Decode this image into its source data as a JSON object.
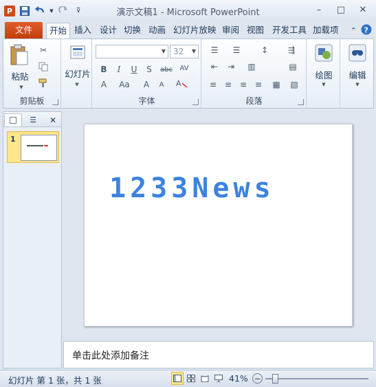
{
  "window": {
    "title": "演示文稿1 - Microsoft PowerPoint",
    "controls": [
      "minimize-icon",
      "maximize-icon",
      "close-icon"
    ]
  },
  "tabs": {
    "file": "文件",
    "items": [
      "开始",
      "插入",
      "设计",
      "切换",
      "动画",
      "幻灯片放映",
      "审阅",
      "视图",
      "开发工具",
      "加载项"
    ],
    "active": "开始"
  },
  "ribbon": {
    "clipboard": {
      "label": "剪贴板",
      "paste": "粘贴"
    },
    "slides": {
      "new_slide": "幻灯片"
    },
    "font": {
      "label": "字体",
      "font_name": "",
      "font_size": "32"
    },
    "paragraph": {
      "label": "段落"
    },
    "drawing": {
      "label": "绘图"
    },
    "editing": {
      "label": "编辑"
    }
  },
  "slide": {
    "text": "1233News",
    "text_color": "#3d82e0"
  },
  "thumbnail": {
    "number": "1"
  },
  "notes": {
    "placeholder": "单击此处添加备注"
  },
  "status": {
    "slide_info": "幻灯片 第 1 张，共 1 张",
    "zoom": "41%"
  }
}
